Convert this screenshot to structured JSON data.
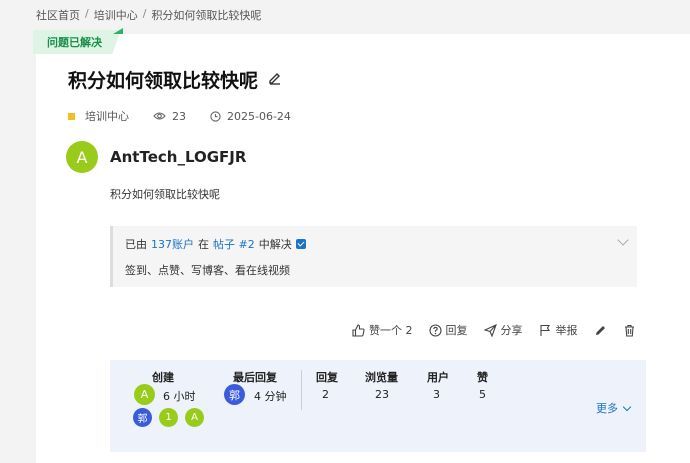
{
  "breadcrumb": {
    "items": [
      "社区首页",
      "培训中心",
      "积分如何领取比较快呢"
    ],
    "separator": "/"
  },
  "badge": {
    "solved": "问题已解决"
  },
  "topic": {
    "title": "积分如何领取比较快呢",
    "category": "培训中心",
    "views": "23",
    "date": "2025-06-24"
  },
  "author": {
    "initial": "A",
    "name": "AntTech_LOGFJR"
  },
  "post": {
    "body": "积分如何领取比较快呢"
  },
  "solution": {
    "prefix": "已由",
    "user": "137账户",
    "mid": "在",
    "post_link": "帖子 #2",
    "suffix": "中解决",
    "text": "签到、点赞、写博客、看在线视频"
  },
  "actions": {
    "like": "赞一个 2",
    "reply": "回复",
    "share": "分享",
    "report": "举报"
  },
  "stats": {
    "created_label": "创建",
    "created_avatar": "A",
    "created_time": "6 小时",
    "last_reply_label": "最后回复",
    "last_reply_avatar": "郭",
    "last_reply_time": "4 分钟",
    "replies_label": "回复",
    "replies": "2",
    "views_label": "浏览量",
    "views": "23",
    "users_label": "用户",
    "users": "3",
    "likes_label": "赞",
    "likes": "5",
    "participants": [
      {
        "initial": "郭",
        "color": "#3b5bdb"
      },
      {
        "initial": "1",
        "color": "#99cc1a"
      },
      {
        "initial": "A",
        "color": "#99cc1a"
      }
    ],
    "more": "更多"
  },
  "colors": {
    "accent": "#1a73c8",
    "avatar_green": "#99cc1a",
    "avatar_blue": "#3b5bdb"
  }
}
